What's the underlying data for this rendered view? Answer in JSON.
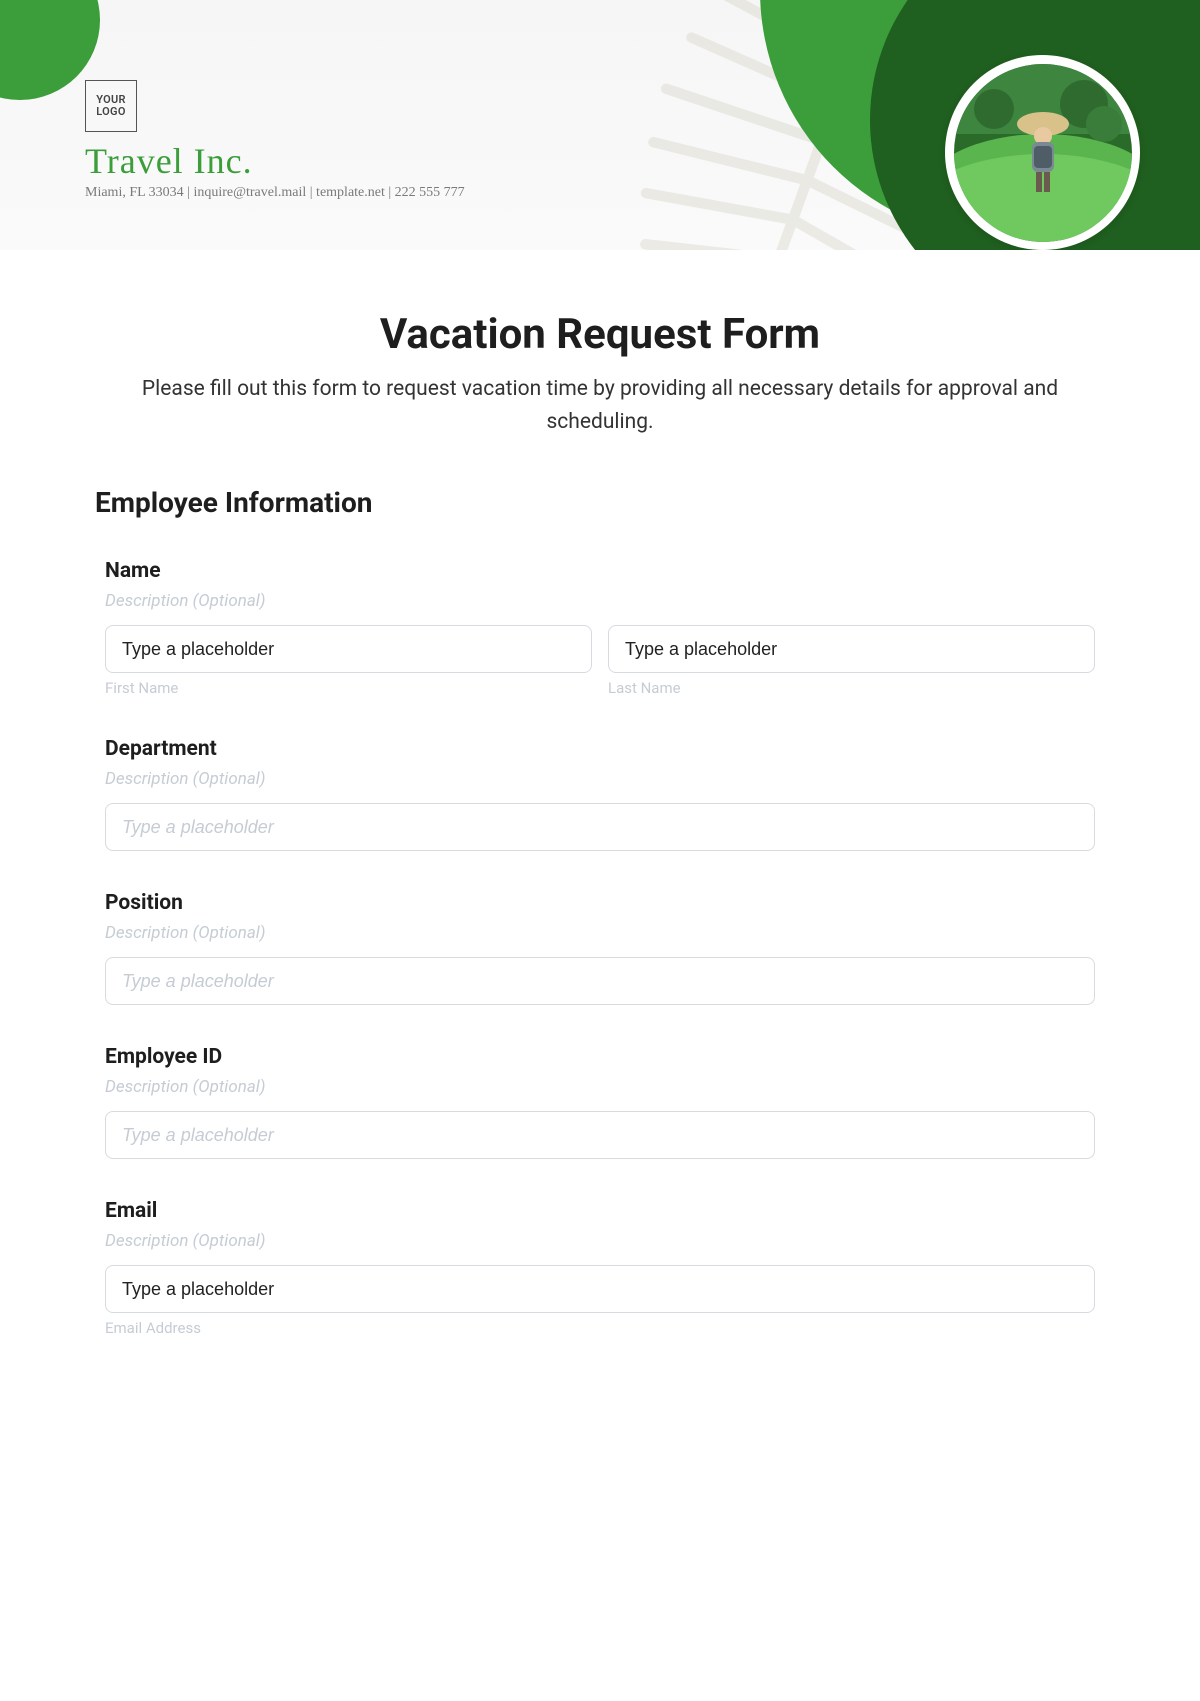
{
  "header": {
    "logo_text": "YOUR LOGO",
    "company_name": "Travel Inc.",
    "company_meta": "Miami, FL 33034 | inquire@travel.mail | template.net | 222 555 777"
  },
  "form": {
    "title": "Vacation Request Form",
    "subtitle": "Please fill out this form to request vacation time by providing all necessary details for approval and scheduling.",
    "section_heading": "Employee Information",
    "fields": {
      "name": {
        "label": "Name",
        "description": "Description (Optional)",
        "first_value": "Type a placeholder",
        "last_value": "Type a placeholder",
        "first_sub": "First Name",
        "last_sub": "Last Name"
      },
      "department": {
        "label": "Department",
        "description": "Description (Optional)",
        "placeholder": "Type a placeholder"
      },
      "position": {
        "label": "Position",
        "description": "Description (Optional)",
        "placeholder": "Type a placeholder"
      },
      "employee_id": {
        "label": "Employee ID",
        "description": "Description (Optional)",
        "placeholder": "Type a placeholder"
      },
      "email": {
        "label": "Email",
        "description": "Description (Optional)",
        "value": "Type a placeholder",
        "sub": "Email Address"
      }
    }
  }
}
